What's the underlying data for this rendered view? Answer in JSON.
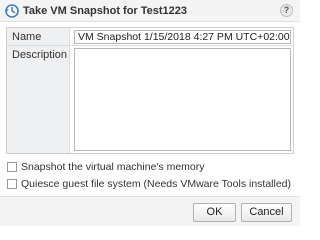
{
  "dialog": {
    "title": "Take VM Snapshot for Test1223",
    "title_icon": "vm-snapshot-icon",
    "help_label": "?"
  },
  "form": {
    "name_label": "Name",
    "name_value": "VM Snapshot 1/15/2018 4:27 PM UTC+02:00",
    "description_label": "Description",
    "description_value": ""
  },
  "options": {
    "snapshot_memory_label": "Snapshot the virtual machine's memory",
    "snapshot_memory_checked": false,
    "quiesce_label": "Quiesce guest file system (Needs VMware Tools installed)",
    "quiesce_checked": false
  },
  "buttons": {
    "ok_label": "OK",
    "cancel_label": "Cancel"
  }
}
